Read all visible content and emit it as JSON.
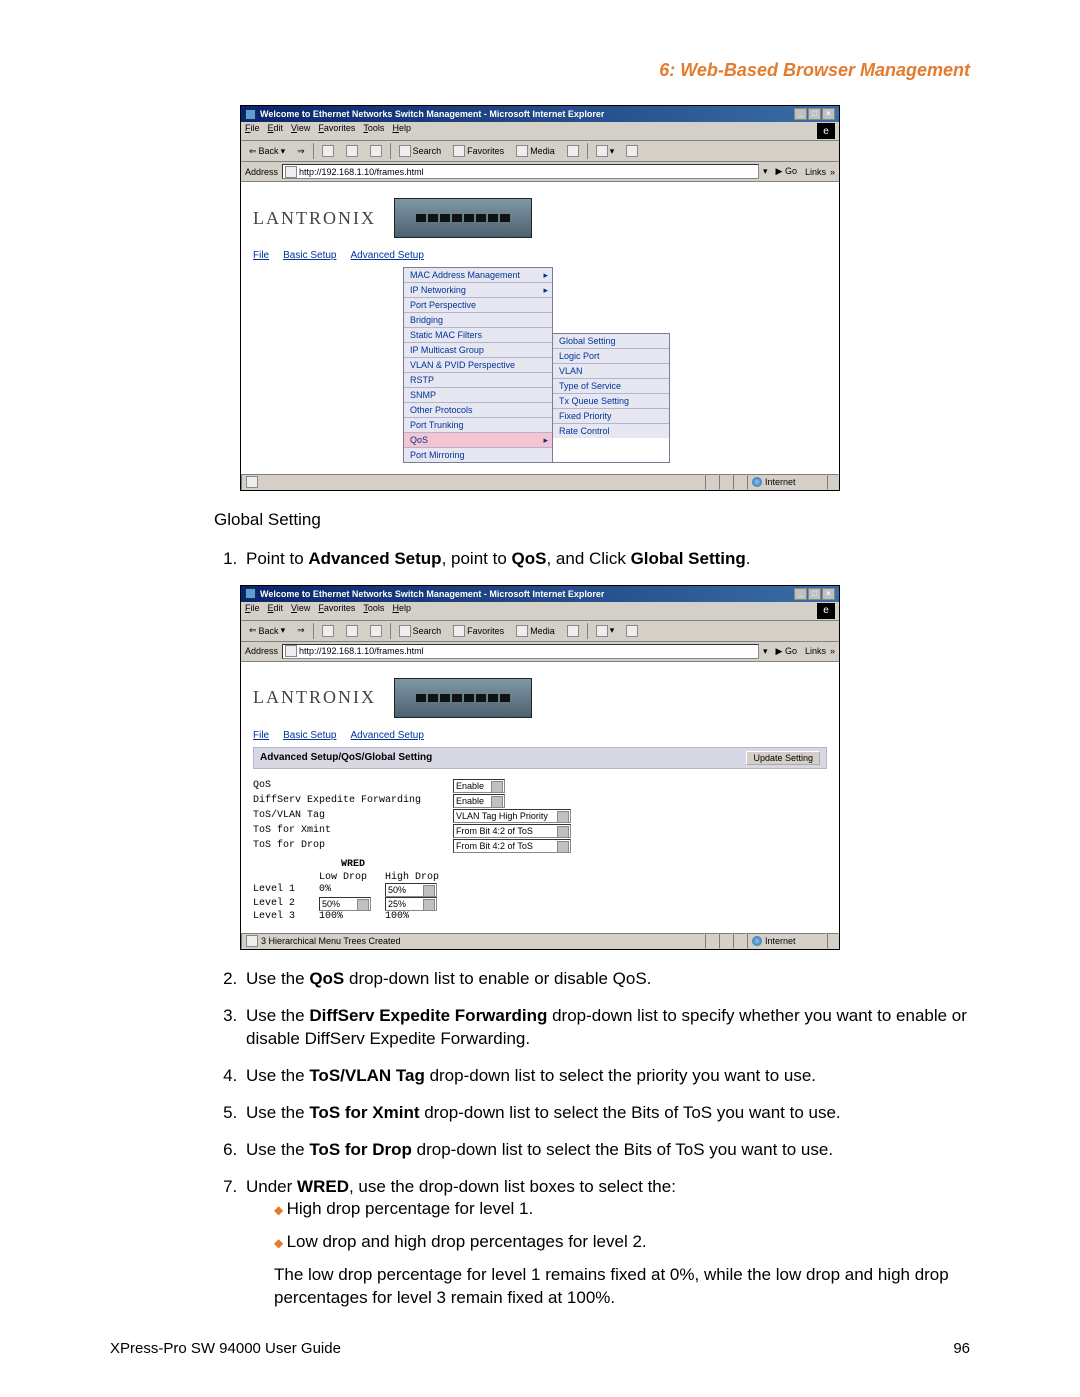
{
  "page": {
    "chapter_title": "6: Web-Based Browser Management",
    "footer_left": "XPress-Pro SW 94000 User Guide",
    "footer_page": "96"
  },
  "ie": {
    "title": "Welcome to Ethernet Networks Switch Management - Microsoft Internet Explorer",
    "menus": [
      "File",
      "Edit",
      "View",
      "Favorites",
      "Tools",
      "Help"
    ],
    "toolbar": {
      "back": "Back",
      "search": "Search",
      "favorites": "Favorites",
      "media": "Media"
    },
    "address_label": "Address",
    "url": "http://192.168.1.10/frames.html",
    "go": "Go",
    "links": "Links",
    "status_internet": "Internet",
    "status2": "3 Hierarchical Menu Trees Created"
  },
  "app": {
    "brand": "LANTRONIX",
    "topnav": [
      "File",
      "Basic Setup",
      "Advanced Setup"
    ],
    "advanced_menu": [
      "MAC Address Management",
      "IP Networking",
      "Port Perspective",
      "Bridging",
      "Static MAC Filters",
      "IP Multicast Group",
      "VLAN & PVID Perspective",
      "RSTP",
      "SNMP",
      "Other Protocols",
      "Port Trunking",
      "QoS",
      "Port Mirroring"
    ],
    "qos_submenu": [
      "Global Setting",
      "Logic Port",
      "VLAN",
      "Type of Service",
      "Tx Queue Setting",
      "Fixed Priority",
      "Rate Control"
    ]
  },
  "global_setting": {
    "breadcrumb": "Advanced Setup/QoS/Global Setting",
    "update_btn": "Update Setting",
    "rows": {
      "qos_label": "QoS",
      "qos_value": "Enable",
      "diffserv_label": "DiffServ Expedite Forwarding",
      "diffserv_value": "Enable",
      "tosvlan_label": "ToS/VLAN Tag",
      "tosvlan_value": "VLAN Tag High Priority",
      "xmint_label": "ToS for Xmint",
      "xmint_value": "From Bit 4:2 of ToS",
      "drop_label": "ToS for Drop",
      "drop_value": "From Bit 4:2 of ToS"
    },
    "wred": {
      "title": "WRED",
      "low": "Low Drop",
      "high": "High Drop",
      "l1": "Level 1",
      "l1_low": "0%",
      "l1_high": "50%",
      "l2": "Level 2",
      "l2_low": "50%",
      "l2_high": "25%",
      "l3": "Level 3",
      "l3_low": "100%",
      "l3_high": "100%"
    }
  },
  "doc": {
    "h_global": "Global Setting",
    "step1_a": "Point to ",
    "step1_b": "Advanced Setup",
    "step1_c": ", point to ",
    "step1_d": "QoS",
    "step1_e": ", and Click ",
    "step1_f": "Global Setting",
    "step1_g": ".",
    "step2_a": "Use the ",
    "step2_b": "QoS",
    "step2_c": " drop-down list to enable or disable QoS.",
    "step3_a": "Use the ",
    "step3_b": "DiffServ Expedite Forwarding",
    "step3_c": " drop-down list to specify whether you want to enable or disable DiffServ Expedite Forwarding.",
    "step4_a": "Use the ",
    "step4_b": "ToS/VLAN Tag",
    "step4_c": " drop-down list to select the priority you want to use.",
    "step5_a": "Use the ",
    "step5_b": "ToS for Xmint",
    "step5_c": " drop-down list to select the Bits of ToS you want to use.",
    "step6_a": "Use the ",
    "step6_b": "ToS for Drop",
    "step6_c": " drop-down list to select the Bits of ToS you want to use.",
    "step7_a": "Under ",
    "step7_b": "WRED",
    "step7_c": ", use the drop-down list boxes to select the:",
    "bullet1": "High drop percentage for level 1.",
    "bullet2": "Low drop and high drop percentages for level 2.",
    "after": "The low drop percentage for level 1 remains fixed at 0%, while the low drop and high drop percentages for level 3 remain fixed at 100%."
  }
}
